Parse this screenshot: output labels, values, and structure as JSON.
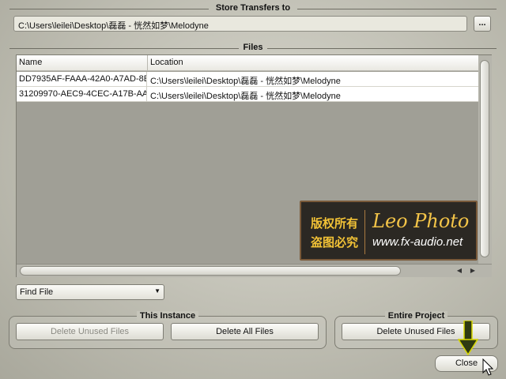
{
  "store_transfers": {
    "title": "Store Transfers to",
    "path": "C:\\Users\\leilei\\Desktop\\磊磊 - 恍然如梦\\Melodyne",
    "browse_label": "..."
  },
  "files": {
    "title": "Files",
    "columns": [
      "Name",
      "Location"
    ],
    "rows": [
      {
        "name": "DD7935AF-FAAA-42A0-A7AD-8E",
        "location": "C:\\Users\\leilei\\Desktop\\磊磊 - 恍然如梦\\Melodyne"
      },
      {
        "name": "31209970-AEC9-4CEC-A17B-AA",
        "location": "C:\\Users\\leilei\\Desktop\\磊磊 - 恍然如梦\\Melodyne"
      }
    ]
  },
  "watermark": {
    "cn_line1": "版权所有",
    "cn_line2": "盗图必究",
    "brand": "Leo Photo",
    "url": "www.fx-audio.net"
  },
  "find_file": {
    "selected": "Find File"
  },
  "this_instance": {
    "title": "This Instance",
    "delete_unused": "Delete Unused Files",
    "delete_all": "Delete All Files"
  },
  "entire_project": {
    "title": "Entire Project",
    "delete_unused": "Delete Unused Files"
  },
  "close_label": "Close",
  "icons": {
    "dropdown": "chevron-down-icon",
    "scroll_left": "arrow-left-icon",
    "scroll_right": "arrow-right-icon",
    "pointer": "down-arrow-annotation-icon",
    "cursor": "mouse-cursor-icon"
  }
}
